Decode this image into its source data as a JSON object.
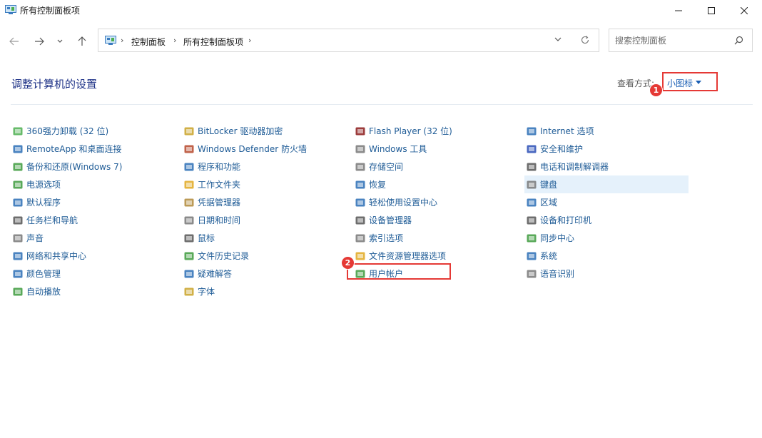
{
  "window": {
    "title": "所有控制面板项"
  },
  "breadcrumb": [
    "控制面板",
    "所有控制面板项"
  ],
  "search": {
    "placeholder": "搜索控制面板"
  },
  "main": {
    "heading": "调整计算机的设置",
    "view_by_label": "查看方式:",
    "view_by_value": "小图标"
  },
  "annotations": {
    "badge1": "1",
    "badge2": "2"
  },
  "colors": {
    "accent": "#1e5b96",
    "heading": "#1e3287",
    "highlight_box": "#e53935",
    "hover_row": "#e5f1fb"
  },
  "items": {
    "col1": [
      {
        "label": "360强力卸载 (32 位)",
        "icon": "uninstall-icon",
        "color": "#4caf50"
      },
      {
        "label": "RemoteApp 和桌面连接",
        "icon": "remote-desktop-icon",
        "color": "#2a6db5"
      },
      {
        "label": "备份和还原(Windows 7)",
        "icon": "backup-icon",
        "color": "#3c9a3c"
      },
      {
        "label": "电源选项",
        "icon": "power-icon",
        "color": "#3c9a3c"
      },
      {
        "label": "默认程序",
        "icon": "default-programs-icon",
        "color": "#2a6db5"
      },
      {
        "label": "任务栏和导航",
        "icon": "taskbar-icon",
        "color": "#555555"
      },
      {
        "label": "声音",
        "icon": "speaker-icon",
        "color": "#777777"
      },
      {
        "label": "网络和共享中心",
        "icon": "network-icon",
        "color": "#2a6db5"
      },
      {
        "label": "颜色管理",
        "icon": "color-management-icon",
        "color": "#2a6db5"
      },
      {
        "label": "自动播放",
        "icon": "autoplay-icon",
        "color": "#3c9a3c"
      }
    ],
    "col2": [
      {
        "label": "BitLocker 驱动器加密",
        "icon": "bitlocker-icon",
        "color": "#c9a227"
      },
      {
        "label": "Windows Defender 防火墙",
        "icon": "firewall-icon",
        "color": "#b5462a"
      },
      {
        "label": "程序和功能",
        "icon": "programs-icon",
        "color": "#2a6db5"
      },
      {
        "label": "工作文件夹",
        "icon": "work-folders-icon",
        "color": "#e0a820"
      },
      {
        "label": "凭据管理器",
        "icon": "credential-icon",
        "color": "#b08a3a"
      },
      {
        "label": "日期和时间",
        "icon": "clock-icon",
        "color": "#777777"
      },
      {
        "label": "鼠标",
        "icon": "mouse-icon",
        "color": "#555555"
      },
      {
        "label": "文件历史记录",
        "icon": "file-history-icon",
        "color": "#3c9a3c"
      },
      {
        "label": "疑难解答",
        "icon": "troubleshoot-icon",
        "color": "#2a6db5"
      },
      {
        "label": "字体",
        "icon": "font-icon",
        "color": "#c9a227"
      }
    ],
    "col3": [
      {
        "label": "Flash Player (32 位)",
        "icon": "flash-icon",
        "color": "#8b1a1a"
      },
      {
        "label": "Windows 工具",
        "icon": "windows-tools-icon",
        "color": "#777777"
      },
      {
        "label": "存储空间",
        "icon": "storage-icon",
        "color": "#777777"
      },
      {
        "label": "恢复",
        "icon": "recovery-icon",
        "color": "#2a6db5"
      },
      {
        "label": "轻松使用设置中心",
        "icon": "ease-of-access-icon",
        "color": "#2a6db5"
      },
      {
        "label": "设备管理器",
        "icon": "device-manager-icon",
        "color": "#555555"
      },
      {
        "label": "索引选项",
        "icon": "indexing-icon",
        "color": "#777777"
      },
      {
        "label": "文件资源管理器选项",
        "icon": "folder-options-icon",
        "color": "#e0a820"
      },
      {
        "label": "用户帐户",
        "icon": "user-accounts-icon",
        "color": "#3c9a3c"
      }
    ],
    "col4": [
      {
        "label": "Internet 选项",
        "icon": "internet-options-icon",
        "color": "#2a6db5"
      },
      {
        "label": "安全和维护",
        "icon": "security-flag-icon",
        "color": "#2a4db5"
      },
      {
        "label": "电话和调制解调器",
        "icon": "phone-modem-icon",
        "color": "#555555"
      },
      {
        "label": "键盘",
        "icon": "keyboard-icon",
        "color": "#777777"
      },
      {
        "label": "区域",
        "icon": "region-icon",
        "color": "#2a6db5"
      },
      {
        "label": "设备和打印机",
        "icon": "printer-icon",
        "color": "#555555"
      },
      {
        "label": "同步中心",
        "icon": "sync-icon",
        "color": "#3c9a3c"
      },
      {
        "label": "系统",
        "icon": "system-icon",
        "color": "#2a6db5"
      },
      {
        "label": "语音识别",
        "icon": "microphone-icon",
        "color": "#777777"
      }
    ]
  }
}
